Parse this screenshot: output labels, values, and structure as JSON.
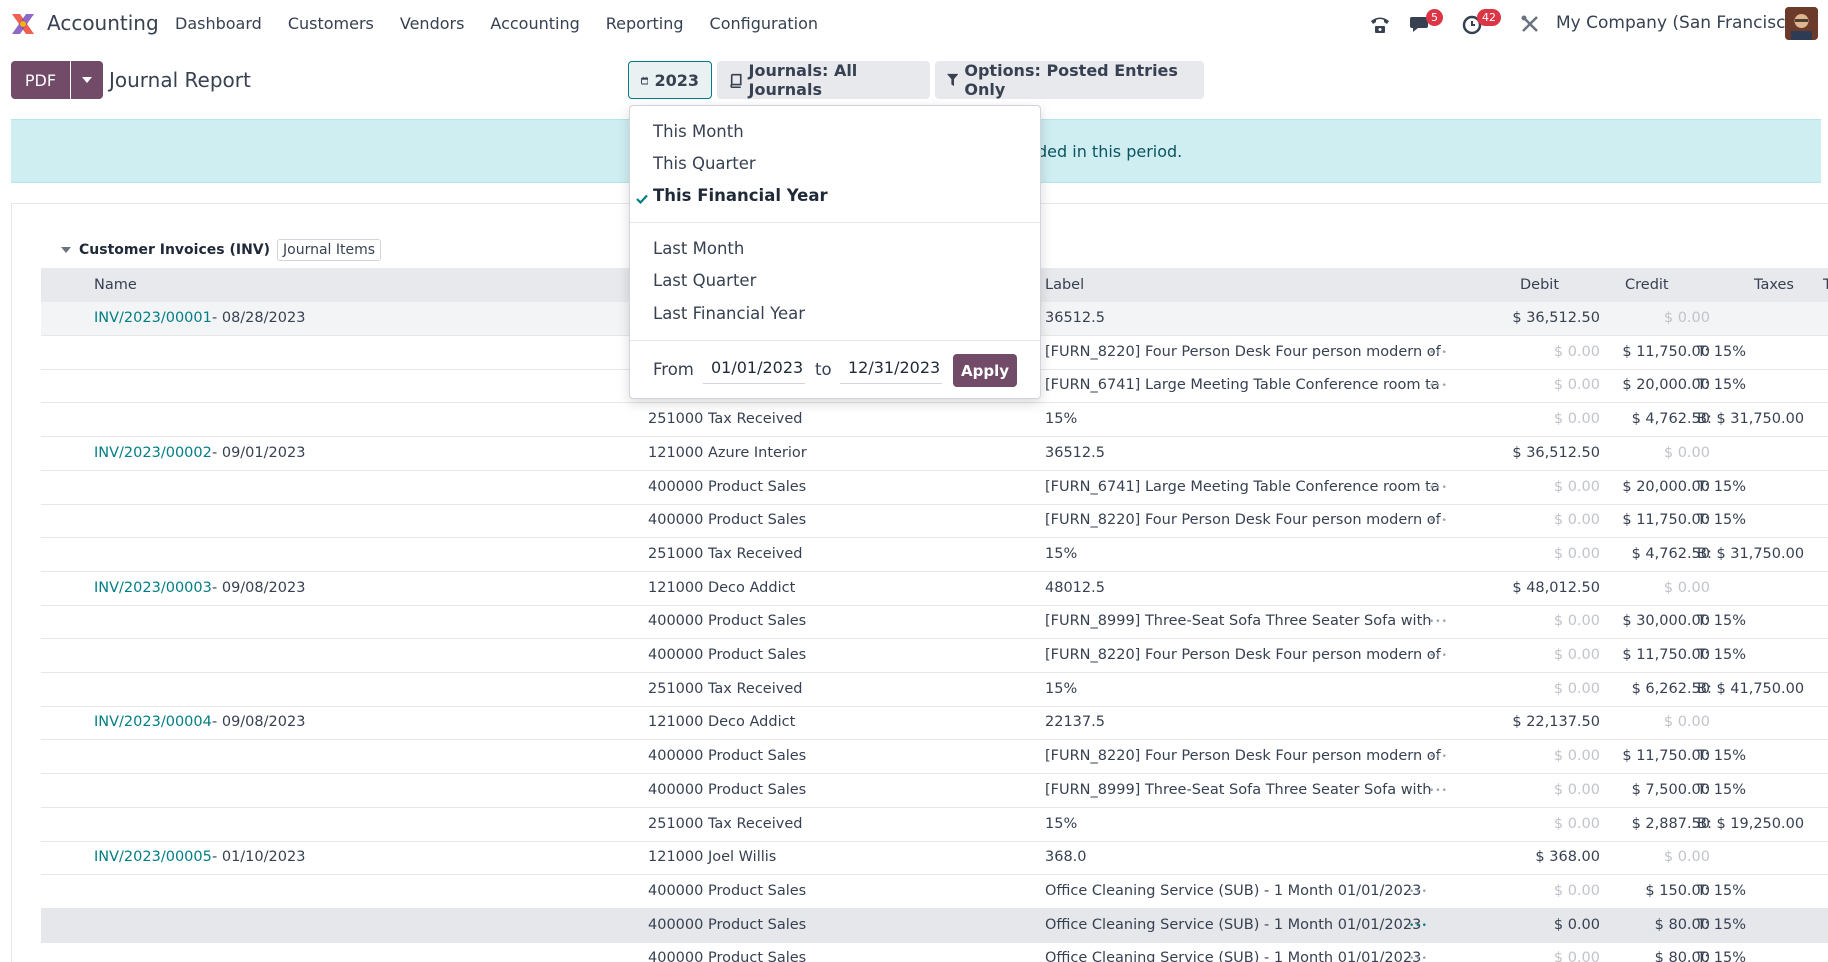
{
  "navbar": {
    "app_name": "Accounting",
    "menu": [
      "Dashboard",
      "Customers",
      "Vendors",
      "Accounting",
      "Reporting",
      "Configuration"
    ],
    "messages_badge": "5",
    "activities_badge": "42",
    "company": "My Company (San Francisco)"
  },
  "control_panel": {
    "pdf_label": "PDF",
    "title": "Journal Report",
    "date_filter": "2023",
    "journals_filter": "Journals: All Journals",
    "options_filter": "Options: Posted Entries Only"
  },
  "alert": {
    "visible_text": "ded in this period."
  },
  "date_dropdown": {
    "items_group1": [
      "This Month",
      "This Quarter",
      "This Financial Year"
    ],
    "selected": "This Financial Year",
    "items_group2": [
      "Last Month",
      "Last Quarter",
      "Last Financial Year"
    ],
    "from_label": "From",
    "from_value": "01/01/2023",
    "to_label": "to",
    "to_value": "12/31/2023",
    "apply_label": "Apply"
  },
  "report": {
    "journal_title": "Customer Invoices (INV)",
    "journal_items_label": "Journal Items",
    "columns": {
      "name": "Name",
      "label": "Label",
      "debit": "Debit",
      "credit": "Credit",
      "taxes": "Taxes",
      "tax_grids": "T"
    },
    "rows": [
      {
        "entry": "INV/2023/00001",
        "date": "- 08/28/2023",
        "account": "",
        "label": "36512.5",
        "debit": "$ 36,512.50",
        "credit": "$ 0.00",
        "taxes": "",
        "debit_muted": false,
        "credit_muted": true,
        "dots": false
      },
      {
        "entry": "",
        "date": "",
        "account": "",
        "label": "[FURN_8220] Four Person Desk Four person modern of",
        "debit": "$ 0.00",
        "credit": "$ 11,750.00",
        "taxes": "T: 15%",
        "debit_muted": true,
        "credit_muted": false,
        "dots": true
      },
      {
        "entry": "",
        "date": "",
        "account": "",
        "label": "[FURN_6741] Large Meeting Table Conference room ta",
        "debit": "$ 0.00",
        "credit": "$ 20,000.00",
        "taxes": "T: 15%",
        "debit_muted": true,
        "credit_muted": false,
        "dots": true
      },
      {
        "entry": "",
        "date": "",
        "account": "251000 Tax Received",
        "label": "15%",
        "debit": "$ 0.00",
        "credit": "$ 4,762.50",
        "taxes": "B: $ 31,750.00",
        "debit_muted": true,
        "credit_muted": false,
        "dots": false
      },
      {
        "entry": "INV/2023/00002",
        "date": "- 09/01/2023",
        "account": "121000 Azure Interior",
        "label": "36512.5",
        "debit": "$ 36,512.50",
        "credit": "$ 0.00",
        "taxes": "",
        "debit_muted": false,
        "credit_muted": true,
        "dots": false
      },
      {
        "entry": "",
        "date": "",
        "account": "400000 Product Sales",
        "label": "[FURN_6741] Large Meeting Table Conference room ta",
        "debit": "$ 0.00",
        "credit": "$ 20,000.00",
        "taxes": "T: 15%",
        "debit_muted": true,
        "credit_muted": false,
        "dots": true
      },
      {
        "entry": "",
        "date": "",
        "account": "400000 Product Sales",
        "label": "[FURN_8220] Four Person Desk Four person modern of",
        "debit": "$ 0.00",
        "credit": "$ 11,750.00",
        "taxes": "T: 15%",
        "debit_muted": true,
        "credit_muted": false,
        "dots": true
      },
      {
        "entry": "",
        "date": "",
        "account": "251000 Tax Received",
        "label": "15%",
        "debit": "$ 0.00",
        "credit": "$ 4,762.50",
        "taxes": "B: $ 31,750.00",
        "debit_muted": true,
        "credit_muted": false,
        "dots": false
      },
      {
        "entry": "INV/2023/00003",
        "date": "- 09/08/2023",
        "account": "121000 Deco Addict",
        "label": "48012.5",
        "debit": "$ 48,012.50",
        "credit": "$ 0.00",
        "taxes": "",
        "debit_muted": false,
        "credit_muted": true,
        "dots": false
      },
      {
        "entry": "",
        "date": "",
        "account": "400000 Product Sales",
        "label": "[FURN_8999] Three-Seat Sofa Three Seater Sofa with",
        "debit": "$ 0.00",
        "credit": "$ 30,000.00",
        "taxes": "T: 15%",
        "debit_muted": true,
        "credit_muted": false,
        "dots": true
      },
      {
        "entry": "",
        "date": "",
        "account": "400000 Product Sales",
        "label": "[FURN_8220] Four Person Desk Four person modern of",
        "debit": "$ 0.00",
        "credit": "$ 11,750.00",
        "taxes": "T: 15%",
        "debit_muted": true,
        "credit_muted": false,
        "dots": true
      },
      {
        "entry": "",
        "date": "",
        "account": "251000 Tax Received",
        "label": "15%",
        "debit": "$ 0.00",
        "credit": "$ 6,262.50",
        "taxes": "B: $ 41,750.00",
        "debit_muted": true,
        "credit_muted": false,
        "dots": false
      },
      {
        "entry": "INV/2023/00004",
        "date": "- 09/08/2023",
        "account": "121000 Deco Addict",
        "label": "22137.5",
        "debit": "$ 22,137.50",
        "credit": "$ 0.00",
        "taxes": "",
        "debit_muted": false,
        "credit_muted": true,
        "dots": false
      },
      {
        "entry": "",
        "date": "",
        "account": "400000 Product Sales",
        "label": "[FURN_8220] Four Person Desk Four person modern of",
        "debit": "$ 0.00",
        "credit": "$ 11,750.00",
        "taxes": "T: 15%",
        "debit_muted": true,
        "credit_muted": false,
        "dots": true
      },
      {
        "entry": "",
        "date": "",
        "account": "400000 Product Sales",
        "label": "[FURN_8999] Three-Seat Sofa Three Seater Sofa with",
        "debit": "$ 0.00",
        "credit": "$ 7,500.00",
        "taxes": "T: 15%",
        "debit_muted": true,
        "credit_muted": false,
        "dots": true
      },
      {
        "entry": "",
        "date": "",
        "account": "251000 Tax Received",
        "label": "15%",
        "debit": "$ 0.00",
        "credit": "$ 2,887.50",
        "taxes": "B: $ 19,250.00",
        "debit_muted": true,
        "credit_muted": false,
        "dots": false
      },
      {
        "entry": "INV/2023/00005",
        "date": "- 01/10/2023",
        "account": "121000 Joel Willis",
        "label": "368.0",
        "debit": "$ 368.00",
        "credit": "$ 0.00",
        "taxes": "",
        "debit_muted": false,
        "credit_muted": true,
        "dots": false
      },
      {
        "entry": "",
        "date": "",
        "account": "400000 Product Sales",
        "label": "Office Cleaning Service (SUB) - 1 Month 01/01/2023",
        "debit": "$ 0.00",
        "credit": "$ 150.00",
        "taxes": "T: 15%",
        "debit_muted": true,
        "credit_muted": false,
        "dots": true
      },
      {
        "entry": "",
        "date": "",
        "account": "400000 Product Sales",
        "label": "Office Cleaning Service (SUB) - 1 Month 01/01/2023",
        "debit": "$ 0.00",
        "credit": "$ 80.00",
        "taxes": "T: 15%",
        "debit_muted": false,
        "credit_muted": false,
        "dots": true,
        "highlight": true
      },
      {
        "entry": "",
        "date": "",
        "account": "400000 Product Sales",
        "label": "Office Cleaning Service (SUB) - 1 Month 01/01/2023",
        "debit": "$ 0.00",
        "credit": "$ 80.00",
        "taxes": "T: 15%",
        "debit_muted": true,
        "credit_muted": false,
        "dots": true
      }
    ]
  },
  "colors": {
    "brand": "#714b67",
    "link": "#017e84",
    "alert_bg": "#cfeef2",
    "badge": "#dc3545"
  }
}
